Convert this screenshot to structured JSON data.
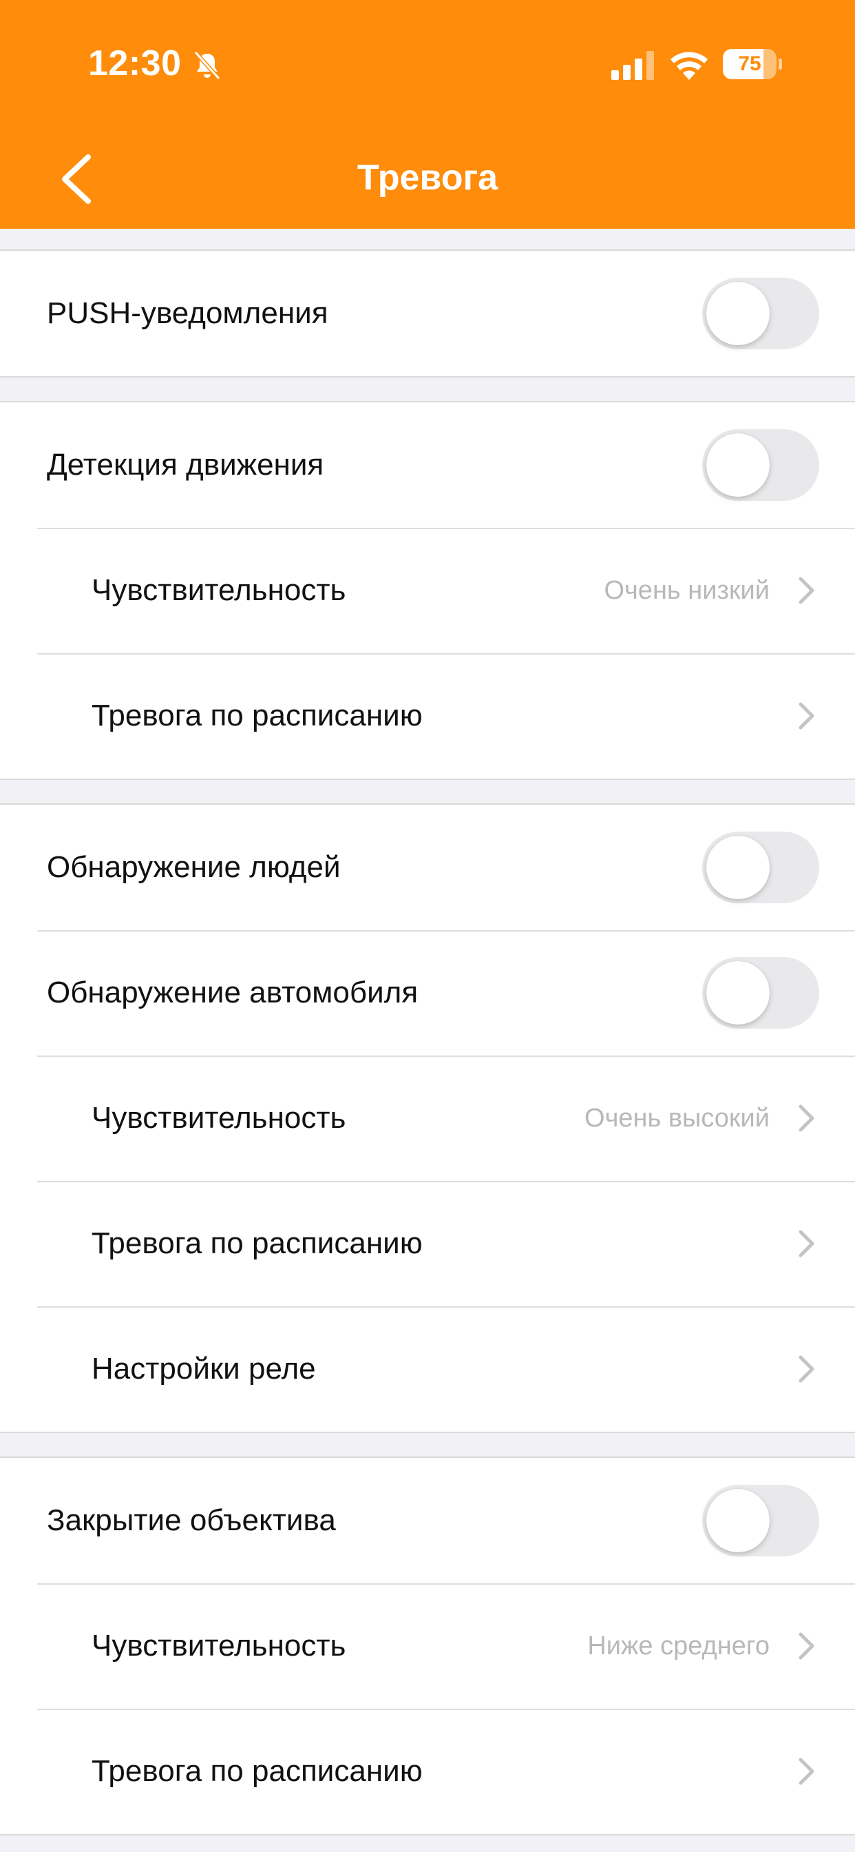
{
  "status_bar": {
    "time": "12:30",
    "battery": "75",
    "battery_level": 0.75
  },
  "nav": {
    "title": "Тревога"
  },
  "sections": [
    {
      "rows": [
        {
          "label": "PUSH-уведомления",
          "type": "toggle",
          "on": false
        }
      ]
    },
    {
      "rows": [
        {
          "label": "Детекция движения",
          "type": "toggle",
          "on": false
        },
        {
          "label": "Чувствительность",
          "type": "link",
          "value": "Очень низкий"
        },
        {
          "label": "Тревога по расписанию",
          "type": "link"
        }
      ]
    },
    {
      "rows": [
        {
          "label": "Обнаружение людей",
          "type": "toggle",
          "on": false
        },
        {
          "label": "Обнаружение автомобиля",
          "type": "toggle",
          "on": false
        },
        {
          "label": "Чувствительность",
          "type": "link",
          "value": "Очень высокий"
        },
        {
          "label": "Тревога по расписанию",
          "type": "link"
        },
        {
          "label": "Настройки реле",
          "type": "link"
        }
      ]
    },
    {
      "rows": [
        {
          "label": "Закрытие объектива",
          "type": "toggle",
          "on": false
        },
        {
          "label": "Чувствительность",
          "type": "link",
          "value": "Ниже среднего"
        },
        {
          "label": "Тревога по расписанию",
          "type": "link"
        }
      ]
    }
  ],
  "colors": {
    "accent": "#ff8c0a",
    "background": "#f1f1f6",
    "toggle_off": "#e9e9eb",
    "value_text": "#b8b8b8"
  }
}
